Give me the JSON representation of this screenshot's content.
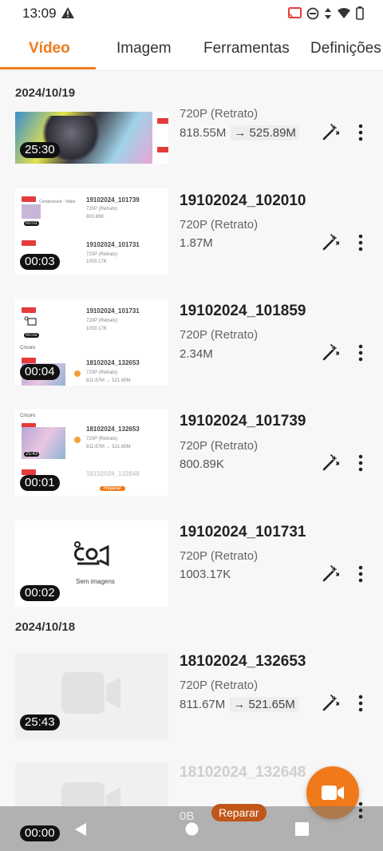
{
  "status_bar": {
    "time": "13:09"
  },
  "tabs": [
    {
      "label": "Vídeo",
      "active": true
    },
    {
      "label": "Imagem",
      "active": false
    },
    {
      "label": "Ferramentas",
      "active": false
    },
    {
      "label": "Definições",
      "active": false
    }
  ],
  "groups": [
    {
      "date": "2024/10/19"
    },
    {
      "date": "2024/10/18"
    }
  ],
  "videos": [
    {
      "title": "",
      "resolution": "720P (Retrato)",
      "size": "818.55M",
      "compressed": "525.89M",
      "duration": "25:30"
    },
    {
      "title": "19102024_102010",
      "resolution": "720P (Retrato)",
      "size": "1.87M",
      "compressed": "",
      "duration": "00:03"
    },
    {
      "title": "19102024_101859",
      "resolution": "720P (Retrato)",
      "size": "2.34M",
      "compressed": "",
      "duration": "00:04"
    },
    {
      "title": "19102024_101739",
      "resolution": "720P (Retrato)",
      "size": "800.89K",
      "compressed": "",
      "duration": "00:01"
    },
    {
      "title": "19102024_101731",
      "resolution": "720P (Retrato)",
      "size": "1003.17K",
      "compressed": "",
      "duration": "00:02"
    },
    {
      "title": "18102024_132653",
      "resolution": "720P (Retrato)",
      "size": "811.67M",
      "compressed": "521.65M",
      "duration": "25:43"
    },
    {
      "title": "18102024_132648",
      "resolution": "",
      "size": "0B",
      "compressed": "",
      "duration": "00:00"
    }
  ],
  "thumb_texts": {
    "t2_name1": "19102024_101739",
    "t2_name2": "19102024_101731",
    "t2_res": "720P (Retrato)",
    "t2_size1": "800.89K",
    "t2_size2": "1003.17K",
    "t2_dur": "00:01",
    "t2_label": "Dorso",
    "t3_name1": "19102024_101731",
    "t3_name2": "18102024_132653",
    "t3_res": "720P (Retrato)",
    "t3_size1": "1003.17K",
    "t3_size2": "811.67M",
    "t3_comp": "521.65M",
    "t3_dur": "00:02",
    "t3_label": "Cricoro",
    "t4_name1": "18102024_132653",
    "t4_name2": "18102024_132648",
    "t4_res": "720P (Retrato)",
    "t4_size": "811.67M",
    "t4_comp": "521.65M",
    "t4_dur": "25:43",
    "t4_label": "Cricoro",
    "t4_repair": "Reparar",
    "t5_noimg": "Sem imagens"
  },
  "repair_button": "Reparar",
  "colors": {
    "accent": "#f07a1a",
    "repair": "#c0561a"
  },
  "icons": [
    "warning-icon",
    "cast-icon",
    "dnd-icon",
    "data-icon",
    "wifi-icon",
    "battery-icon",
    "magic-wand-icon",
    "more-vert-icon",
    "video-camera-icon",
    "back-icon",
    "home-icon",
    "recents-icon"
  ]
}
